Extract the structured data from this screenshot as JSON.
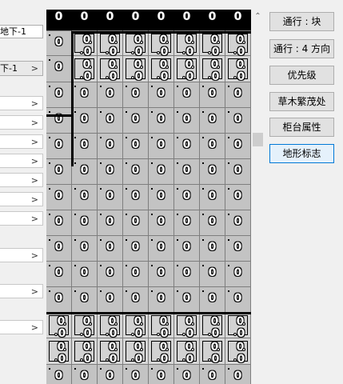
{
  "left_panel": {
    "floor_field": "地下-1",
    "floor_select": "下-1",
    "empty_rows": 8
  },
  "tile_label": "0",
  "map": {
    "columns": 8,
    "top_row_color": "#000000",
    "tile_color": "#c3c3c3",
    "grid_line_color": "#7e7e7e"
  },
  "right_buttons": [
    {
      "id": "pass-block",
      "label": "通行 : 块",
      "active": false
    },
    {
      "id": "pass-4dir",
      "label": "通行 : 4 方向",
      "active": false
    },
    {
      "id": "priority",
      "label": "优先级",
      "active": false
    },
    {
      "id": "bush",
      "label": "草木繁茂处",
      "active": false
    },
    {
      "id": "counter",
      "label": "柜台属性",
      "active": false
    },
    {
      "id": "terrain-tag",
      "label": "地形标志",
      "active": true
    }
  ],
  "scrollbar": {
    "up_arrow": "^"
  },
  "accent_color": "#0078d7"
}
